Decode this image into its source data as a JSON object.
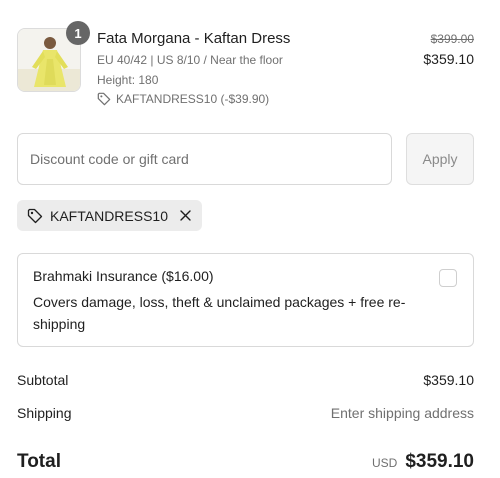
{
  "product": {
    "quantity": "1",
    "name": "Fata Morgana - Kaftan Dress",
    "variant": "EU 40/42 | US 8/10 / Near the floor",
    "height": "Height: 180",
    "discount_line": "KAFTANDRESS10 (-$39.90)",
    "original_price": "$399.00",
    "price": "$359.10",
    "image_icon": "kaftan-dress-thumbnail",
    "colors": {
      "dress": "#e9e56a",
      "background": "#f6f6f4"
    }
  },
  "discount": {
    "placeholder": "Discount code or gift card",
    "apply_label": "Apply",
    "applied_code": "KAFTANDRESS10"
  },
  "insurance": {
    "title": "Brahmaki Insurance ($16.00)",
    "description": "Covers damage, loss, theft & unclaimed packages + free re-shipping",
    "checked": false
  },
  "summary": {
    "subtotal_label": "Subtotal",
    "subtotal_value": "$359.10",
    "shipping_label": "Shipping",
    "shipping_value": "Enter shipping address",
    "total_label": "Total",
    "currency": "USD",
    "total_value": "$359.10"
  }
}
